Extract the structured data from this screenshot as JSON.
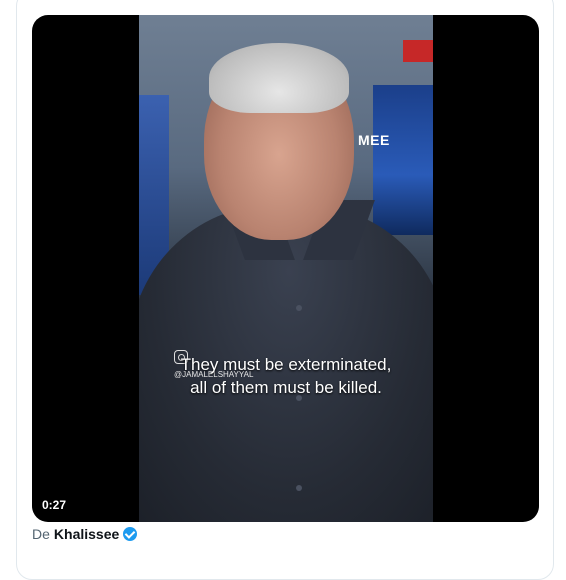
{
  "video": {
    "duration": "0:27",
    "caption_line1": "They must be exterminated,",
    "caption_line2": "all of them must be killed.",
    "watermark": "@JAMALELSHAYYAL",
    "logo": "MEE"
  },
  "byline": {
    "prefix": "De",
    "author": "Khalissee"
  },
  "colors": {
    "verified": "#1d9bf0",
    "text": "#0f1419",
    "muted": "#536471"
  }
}
